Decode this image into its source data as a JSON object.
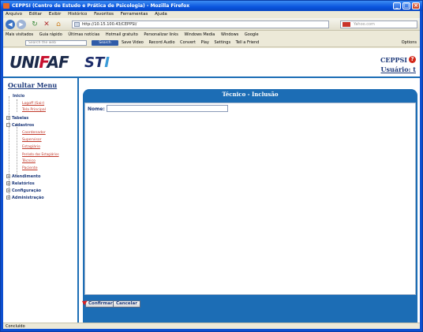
{
  "window": {
    "title": "CEPPSI (Centro de Estudo e Prática de Psicologia) - Mozilla Firefox"
  },
  "menubar": {
    "items": [
      "Arquivo",
      "Editar",
      "Exibir",
      "Histórico",
      "Favoritos",
      "Ferramentas",
      "Ajuda"
    ]
  },
  "navbar": {
    "url": "http://10.15.100.43/CEPPSI/",
    "search_placeholder": "Yahoo.com"
  },
  "bookmarks": {
    "items": [
      "Mais visitados",
      "Guia rápido",
      "Últimas notícias",
      "Hotmail gratuito",
      "Personalizar links",
      "Windows Media",
      "Windows",
      "Google"
    ]
  },
  "toolbar2": {
    "search_placeholder": "Search the web",
    "search_button": "Search",
    "items": [
      "Save Video",
      "Record Audio",
      "Convert",
      "Play",
      "Settings",
      "Tell a Friend"
    ],
    "options_label": "Options"
  },
  "header": {
    "logo_text": "UNIFAF",
    "sti_text": "STI",
    "org_name": "CEPPSI",
    "user_label": "Usuário: t"
  },
  "sidebar": {
    "hide_menu_label": "Ocultar Menu",
    "tree": {
      "inicio": "Inicio",
      "logoff": "Logoff (Sair)",
      "tela_principal": "Tela Principal",
      "tabelas": "Tabelas",
      "cadastros": "Cadastros",
      "coordenador": "Coordenador",
      "supervisor": "Supervisor",
      "estagiario": "Estagiário",
      "periodo": "Período dos Estagiários",
      "tecnico": "Técnico",
      "paciente": "Paciente",
      "atendimento": "Atendimento",
      "relatorios": "Relatórios",
      "configuracao": "Configuração",
      "administracao": "Administração"
    }
  },
  "main": {
    "title": "Técnico - Inclusão",
    "nome_label": "Nome:",
    "nome_value": "",
    "confirm_label": "Confirmar",
    "cancel_label": "Cancelar"
  },
  "status": {
    "text": "Concluído"
  },
  "colors": {
    "accent": "#1c6db5",
    "title_blue": "#1e3a7b",
    "link_red": "#c0392b"
  }
}
